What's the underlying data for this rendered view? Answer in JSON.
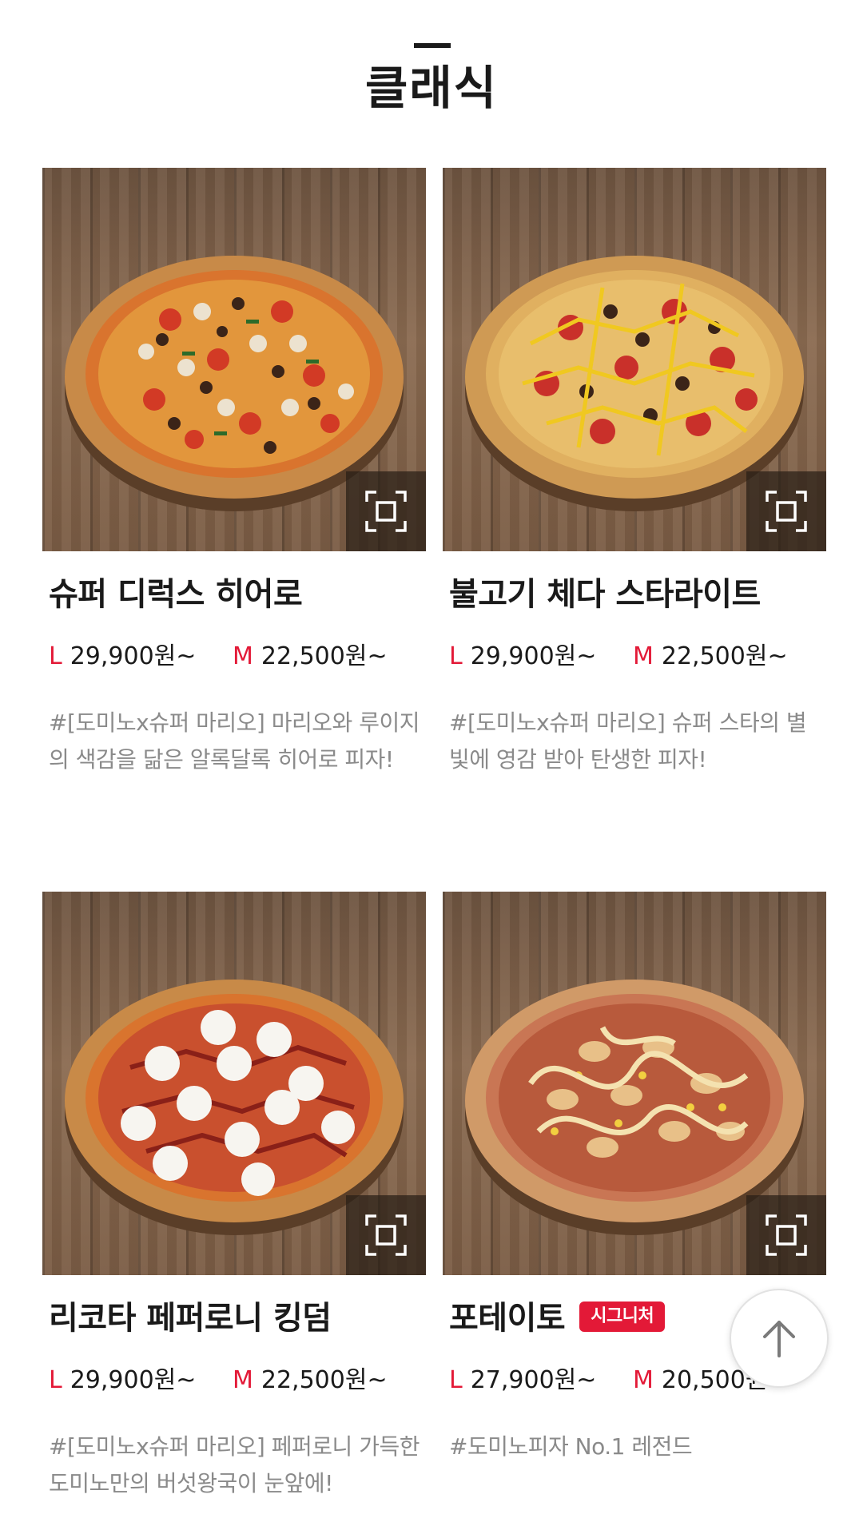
{
  "section": {
    "title": "클래식"
  },
  "labels": {
    "large": "L",
    "medium": "M"
  },
  "products": [
    {
      "name": "슈퍼 디럭스 히어로",
      "badge": "",
      "price_l": "29,900원~",
      "price_m": "22,500원~",
      "description": "#[도미노x슈퍼 마리오] 마리오와 루이지의 색감을 닮은 알록달록 히어로 피자!"
    },
    {
      "name": "불고기 체다 스타라이트",
      "badge": "",
      "price_l": "29,900원~",
      "price_m": "22,500원~",
      "description": "#[도미노x슈퍼 마리오] 슈퍼 스타의 별빛에 영감 받아 탄생한 피자!"
    },
    {
      "name": "리코타 페퍼로니 킹덤",
      "badge": "",
      "price_l": "29,900원~",
      "price_m": "22,500원~",
      "description": "#[도미노x슈퍼 마리오] 페퍼로니 가득한 도미노만의 버섯왕국이 눈앞에!"
    },
    {
      "name": "포테이토",
      "badge": "시그니처",
      "price_l": "27,900원~",
      "price_m": "20,500원~",
      "description": "#도미노피자 No.1 레전드"
    }
  ],
  "icons": {
    "zoom": "expand-frame-icon",
    "scroll_top": "arrow-up-icon"
  },
  "colors": {
    "accent": "#e31937",
    "text": "#1a1a1a",
    "muted": "#8a8a8a"
  }
}
